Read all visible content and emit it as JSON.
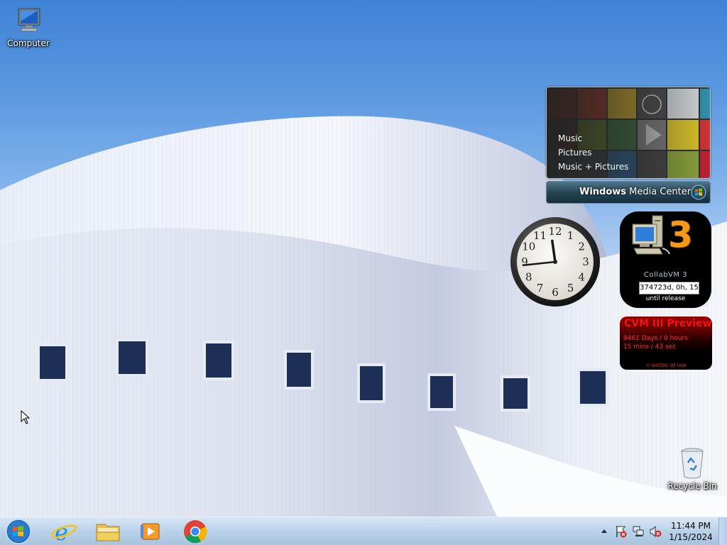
{
  "desktop": {
    "icons": [
      {
        "label": "Computer",
        "icon": "computer-icon"
      },
      {
        "label": "Recycle Bin",
        "icon": "recycle-bin-icon"
      }
    ]
  },
  "gadgets": {
    "media_center": {
      "menu": [
        "Music",
        "Pictures",
        "Music + Pictures"
      ],
      "bar_label_bold": "Windows",
      "bar_label_rest": " Media Center"
    },
    "clock": {
      "numerals": [
        "12",
        "1",
        "2",
        "3",
        "4",
        "5",
        "6",
        "7",
        "8",
        "9",
        "10",
        "11"
      ],
      "time": "11:44"
    },
    "collabvm": {
      "digit": "3",
      "name": "CollabVM 3",
      "countdown": "374723d, 0h, 15",
      "until": "until release"
    },
    "preview": {
      "title": "CVM III Preview",
      "line1": "9461 Days / 0 hours",
      "line2": "15 mins / 43 sec",
      "copyright": "© SHITDIC OF USA"
    }
  },
  "taskbar": {
    "pinned": [
      {
        "name": "start-button",
        "icon": "windows-orb-icon"
      },
      {
        "name": "internet-explorer-button",
        "icon": "ie-icon"
      },
      {
        "name": "file-explorer-button",
        "icon": "folder-icon"
      },
      {
        "name": "media-player-button",
        "icon": "media-player-icon"
      },
      {
        "name": "chrome-button",
        "icon": "chrome-icon"
      }
    ],
    "tray": {
      "icons": [
        "show-hidden-icons-icon",
        "action-center-icon",
        "network-icon",
        "volume-muted-icon"
      ]
    },
    "clock": {
      "time": "11:44 PM",
      "date": "1/15/2024"
    }
  },
  "colors": {
    "sky": "#3f83d6",
    "building": "#dfe6f2",
    "taskbar": "#bcd3ea",
    "cvm_orange": "#f39a16",
    "preview_red": "#ff1010"
  }
}
